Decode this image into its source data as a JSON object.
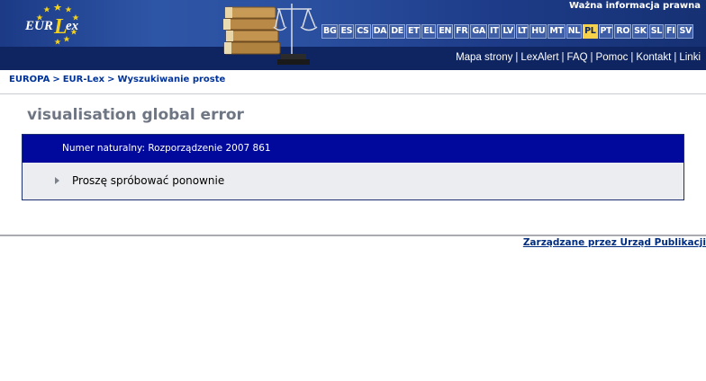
{
  "header": {
    "legal_notice": "Ważna informacja prawna",
    "logo_text": "EUR-Lex",
    "languages": [
      "BG",
      "ES",
      "CS",
      "DA",
      "DE",
      "ET",
      "EL",
      "EN",
      "FR",
      "GA",
      "IT",
      "LV",
      "LT",
      "HU",
      "MT",
      "NL",
      "PL",
      "PT",
      "RO",
      "SK",
      "SL",
      "FI",
      "SV"
    ],
    "active_language": "PL",
    "nav_links": [
      "Mapa strony",
      "LexAlert",
      "FAQ",
      "Pomoc",
      "Kontakt",
      "Linki"
    ],
    "nav_separator": "|"
  },
  "breadcrumb": {
    "items": [
      "EUROPA",
      "EUR-Lex",
      "Wyszukiwanie proste"
    ],
    "separator": ">"
  },
  "main": {
    "title": "visualisation global error",
    "panel_header": "Numer naturalny: Rozporządzenie 2007 861",
    "retry_link": "Proszę spróbować ponownie"
  },
  "footer": {
    "managed_by": "Zarządzane przez Urząd Publikacji"
  },
  "colors": {
    "banner_top": "#2a4f9e",
    "banner_bottom": "#0f2561",
    "active_language_bg": "#f6d24a",
    "panel_header_bg": "#00099b",
    "panel_body_bg": "#ecedf0",
    "link_blue": "#003399"
  },
  "icons": {
    "logo": "eur-lex-logo",
    "banner_image": "books-and-scales-image",
    "retry_bullet": "triangle-right-icon"
  }
}
